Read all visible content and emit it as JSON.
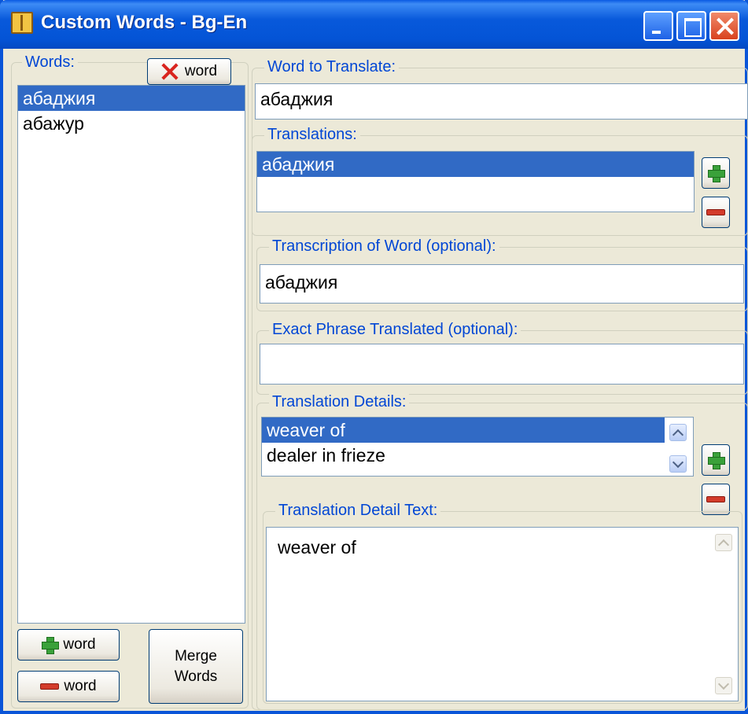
{
  "window": {
    "title": "Custom Words - Bg-En"
  },
  "words_panel": {
    "legend": "Words:",
    "delete_button_label": "word",
    "items": [
      {
        "label": "абаджия",
        "selected": true
      },
      {
        "label": "абажур",
        "selected": false
      }
    ],
    "add_button_label": "word",
    "remove_button_label": "word",
    "merge_button_label_line1": "Merge",
    "merge_button_label_line2": "Words"
  },
  "word_to_translate": {
    "legend": "Word to Translate:",
    "value": "абаджия"
  },
  "translations": {
    "legend": "Translations:",
    "items": [
      {
        "label": "абаджия",
        "selected": true
      }
    ]
  },
  "transcription": {
    "legend": "Transcription of Word (optional):",
    "value": "абаджия"
  },
  "exact_phrase": {
    "legend": "Exact Phrase Translated (optional):",
    "value": ""
  },
  "translation_details": {
    "legend": "Translation Details:",
    "items": [
      {
        "label": "weaver of",
        "selected": true
      },
      {
        "label": "dealer in frieze",
        "selected": false
      }
    ]
  },
  "detail_text": {
    "legend": "Translation Detail Text:",
    "value": "weaver of"
  },
  "colors": {
    "title_bar": "#0a55d8",
    "selection": "#316ac5",
    "legend_text": "#0046d5",
    "window_bg": "#ece9d8"
  }
}
